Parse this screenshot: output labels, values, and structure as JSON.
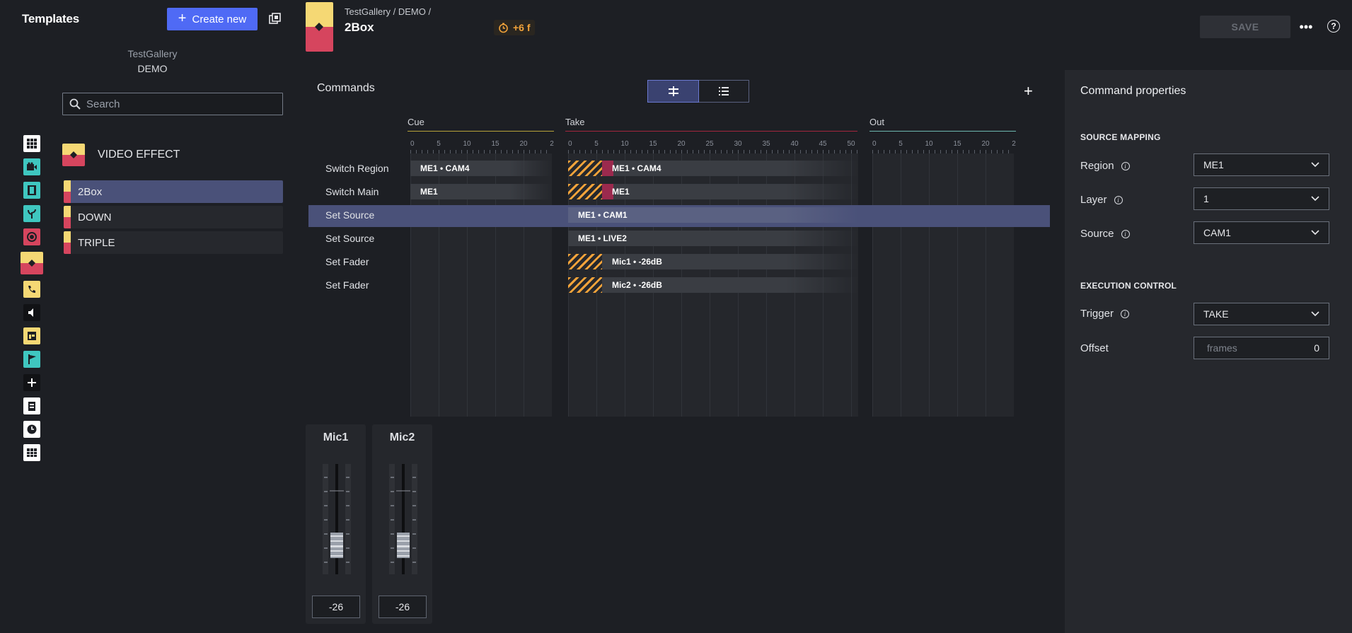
{
  "left": {
    "title": "Templates",
    "create_button": "Create new",
    "gallery_name": "TestGallery",
    "gallery_sub": "DEMO",
    "search_placeholder": "Search",
    "category_label": "VIDEO EFFECT",
    "templates": [
      {
        "name": "2Box",
        "active": true
      },
      {
        "name": "DOWN",
        "active": false
      },
      {
        "name": "TRIPLE",
        "active": false
      }
    ],
    "rail_icons": [
      "grid-icon",
      "camera-icon",
      "film-icon",
      "plant-icon",
      "record-icon",
      "video-effect-icon",
      "phone-icon",
      "speaker-icon",
      "layout-icon",
      "flag-icon",
      "plus-icon",
      "clipboard-icon",
      "clock-icon",
      "table-icon"
    ]
  },
  "header": {
    "breadcrumb": "TestGallery / DEMO /",
    "title": "2Box",
    "offset_badge": "+6 f",
    "save_label": "SAVE"
  },
  "commands": {
    "title": "Commands",
    "sections": [
      "Cue",
      "Take",
      "Out"
    ],
    "ruler_cue": [
      "0",
      "5",
      "10",
      "15",
      "20",
      "2"
    ],
    "ruler_take": [
      "0",
      "5",
      "10",
      "15",
      "20",
      "25",
      "30",
      "35",
      "40",
      "45",
      "50"
    ],
    "ruler_out": [
      "0",
      "5",
      "10",
      "15",
      "20",
      "2"
    ],
    "rows": [
      {
        "label": "Switch Region",
        "cue": "ME1 • CAM4",
        "take": "ME1 • CAM4"
      },
      {
        "label": "Switch Main",
        "cue": "ME1",
        "take": "ME1"
      },
      {
        "label": "Set Source",
        "cue": "",
        "take": "ME1 • CAM1"
      },
      {
        "label": "Set Source",
        "cue": "",
        "take": "ME1 • LIVE2"
      },
      {
        "label": "Set Fader",
        "cue": "",
        "take": "Mic1 • -26dB"
      },
      {
        "label": "Set Fader",
        "cue": "",
        "take": "Mic2 • -26dB"
      }
    ]
  },
  "mixer": {
    "channels": [
      {
        "name": "Mic1",
        "value": "-26"
      },
      {
        "name": "Mic2",
        "value": "-26"
      }
    ]
  },
  "props": {
    "title": "Command properties",
    "source_mapping": "SOURCE MAPPING",
    "region_label": "Region",
    "region_value": "ME1",
    "layer_label": "Layer",
    "layer_value": "1",
    "source_label": "Source",
    "source_value": "CAM1",
    "execution_control": "EXECUTION CONTROL",
    "trigger_label": "Trigger",
    "trigger_value": "TAKE",
    "offset_label": "Offset",
    "offset_placeholder": "frames",
    "offset_value": "0"
  },
  "colors": {
    "accent": "#4f6af5",
    "yellow": "#f5d874",
    "pink": "#d6455e",
    "hatch": "#f2a33a",
    "take_red": "#9b2a4e",
    "selected_row": "#4a5179"
  }
}
